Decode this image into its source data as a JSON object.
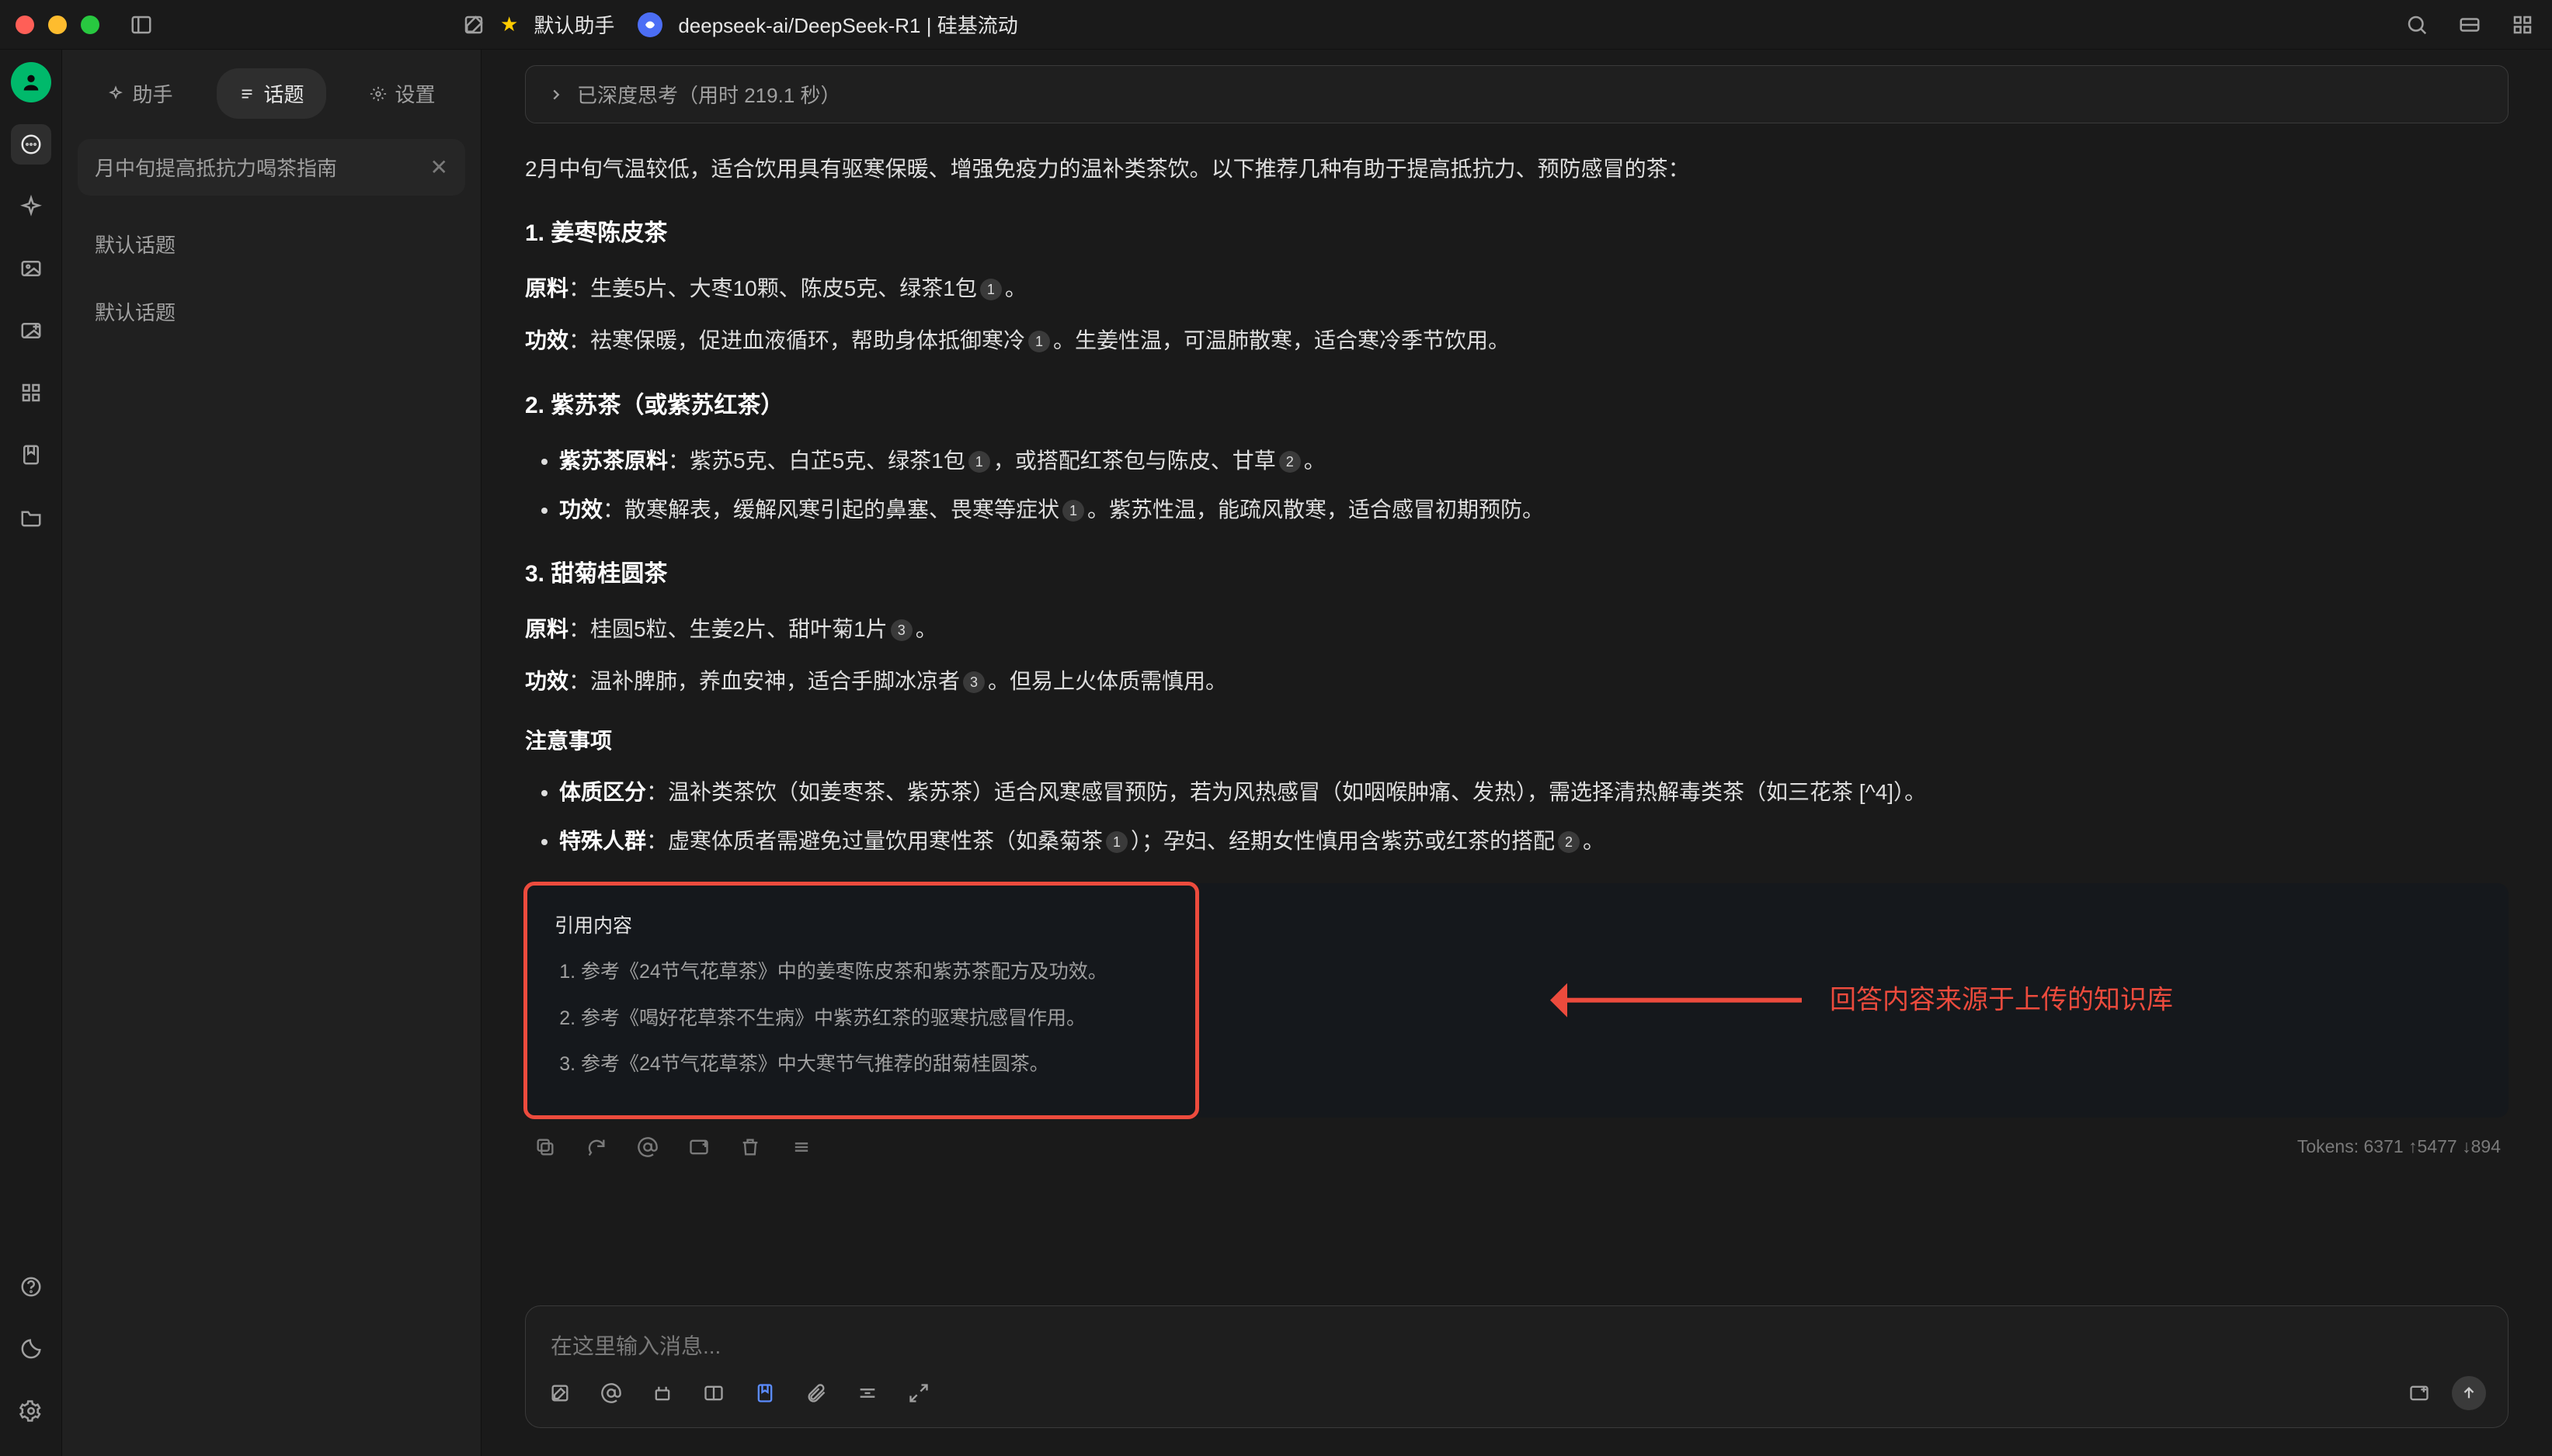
{
  "titlebar": {
    "default_assistant": "默认助手",
    "model": "deepseek-ai/DeepSeek-R1 | 硅基流动"
  },
  "sidebar": {
    "tabs": {
      "assistant": "助手",
      "topic": "话题",
      "settings": "设置"
    },
    "search": "月中旬提高抵抗力喝茶指南",
    "topics": [
      "默认话题",
      "默认话题"
    ]
  },
  "chat": {
    "think": "已深度思考（用时 219.1 秒）",
    "intro": "2月中旬气温较低，适合饮用具有驱寒保暖、增强免疫力的温补类茶饮。以下推荐几种有助于提高抵抗力、预防感冒的茶：",
    "s1": {
      "h": "1. 姜枣陈皮茶",
      "raw_l": "原料",
      "raw": "：生姜5片、大枣10颗、陈皮5克、绿茶1包",
      "raw_tail": "。",
      "eff_l": "功效",
      "eff": "：祛寒保暖，促进血液循环，帮助身体抵御寒冷",
      "eff_tail": "。生姜性温，可温肺散寒，适合寒冷季节饮用。"
    },
    "s2": {
      "h": "2. 紫苏茶（或紫苏红茶）",
      "li1_l": "紫苏茶原料",
      "li1": "：紫苏5克、白芷5克、绿茶1包",
      "li1_tail": "，或搭配红茶包与陈皮、甘草",
      "li1_tail2": "。",
      "li2_l": "功效",
      "li2": "：散寒解表，缓解风寒引起的鼻塞、畏寒等症状",
      "li2_tail": "。紫苏性温，能疏风散寒，适合感冒初期预防。"
    },
    "s3": {
      "h": "3. 甜菊桂圆茶",
      "raw_l": "原料",
      "raw": "：桂圆5粒、生姜2片、甜叶菊1片",
      "raw_tail": "。",
      "eff_l": "功效",
      "eff": "：温补脾肺，养血安神，适合手脚冰凉者",
      "eff_tail": "。但易上火体质需慎用。"
    },
    "notes": {
      "h": "注意事项",
      "li1_l": "体质区分",
      "li1": "：温补类茶饮（如姜枣茶、紫苏茶）适合风寒感冒预防，若为风热感冒（如咽喉肿痛、发热），需选择清热解毒类茶（如三花茶 [^4]）。",
      "li2_l": "特殊人群",
      "li2a": "：虚寒体质者需避免过量饮用寒性茶（如桑菊茶",
      "li2b": "）；孕妇、经期女性慎用含紫苏或红茶的搭配",
      "li2c": "。"
    },
    "refs": {
      "title": "引用内容",
      "items": [
        "参考《24节气花草茶》中的姜枣陈皮茶和紫苏茶配方及功效。",
        "参考《喝好花草茶不生病》中紫苏红茶的驱寒抗感冒作用。",
        "参考《24节气花草茶》中大寒节气推荐的甜菊桂圆茶。"
      ]
    },
    "annotation": "回答内容来源于上传的知识库",
    "tokens": "Tokens: 6371 ↑5477 ↓894"
  },
  "composer": {
    "placeholder": "在这里输入消息..."
  },
  "cites": {
    "c1": "1",
    "c2": "2",
    "c3": "3"
  }
}
